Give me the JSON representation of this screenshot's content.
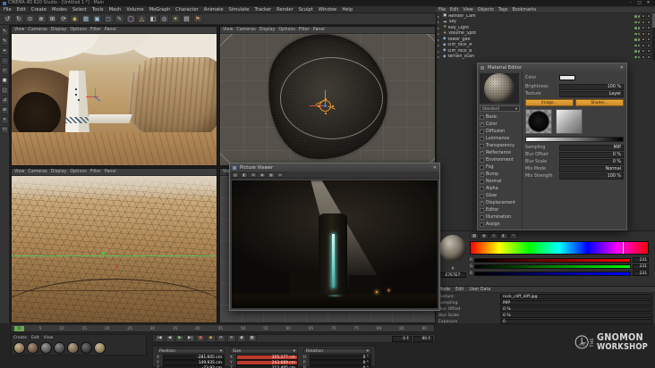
{
  "glyphs": {
    "caret": "▾",
    "close": "✕",
    "hash": "#"
  },
  "titlebar": {
    "title": "CINEMA 4D R20 Studio - [Untitled 1 *] - Main",
    "controls": [
      "–",
      "□",
      "✕"
    ]
  },
  "menubar": {
    "items": [
      "File",
      "Edit",
      "Create",
      "Modes",
      "Select",
      "Tools",
      "Mesh",
      "Volume",
      "MoGraph",
      "Character",
      "Animate",
      "Simulate",
      "Tracker",
      "Render",
      "Sculpt",
      "Window",
      "Help"
    ]
  },
  "toolbar": {
    "icons": [
      {
        "glyph": "↺",
        "color": "#cccccc"
      },
      {
        "glyph": "↻",
        "color": "#cccccc"
      },
      {
        "glyph": "⊙",
        "color": "#d8d8d8"
      },
      {
        "glyph": "⊕",
        "color": "#d8d8d8"
      },
      {
        "glyph": "⊞",
        "color": "#d8d8d8"
      },
      {
        "glyph": "⟳",
        "color": "#d8d8d8"
      },
      {
        "glyph": "◆",
        "color": "#c2a84e"
      },
      {
        "glyph": "▦",
        "color": "#9fc2dd"
      },
      {
        "glyph": "▣",
        "color": "#9fc2dd"
      },
      {
        "glyph": "◻",
        "color": "#8fb6d8"
      },
      {
        "glyph": "✎",
        "color": "#9ed09a"
      },
      {
        "glyph": "◯",
        "color": "#c9a2d8"
      },
      {
        "glyph": "△",
        "color": "#d8b98f"
      },
      {
        "glyph": "◧",
        "color": "#cccccc"
      },
      {
        "glyph": "◎",
        "color": "#cccccc"
      },
      {
        "glyph": "☀",
        "color": "#e2cf6f"
      },
      {
        "glyph": "▤",
        "color": "#cccccc"
      },
      {
        "glyph": "⚑",
        "color": "#cf8f5f"
      }
    ]
  },
  "left_toolbar": {
    "icons": [
      "↖",
      "✎",
      "⌖",
      "∴",
      "▱",
      "◼",
      "◻",
      "⊿",
      "≡",
      "⋄",
      "▭"
    ]
  },
  "viewports": {
    "menu": [
      "View",
      "Cameras",
      "Display",
      "Options",
      "Filter",
      "Panel"
    ]
  },
  "picture_viewer": {
    "title": "Picture Viewer",
    "toolbar_icons": [
      "▤",
      "◧",
      "⊞",
      "◉",
      "▦",
      "⇔"
    ]
  },
  "objects": {
    "menu": [
      "File",
      "Edit",
      "View",
      "Objects",
      "Tags",
      "Bookmarks"
    ],
    "rows": [
      {
        "icon": "▣",
        "c": "#cfd8de",
        "name": "Render_Cam"
      },
      {
        "icon": "☁",
        "c": "#9fc4e0",
        "name": "Sky"
      },
      {
        "icon": "☀",
        "c": "#e6cf6a",
        "name": "Key_Light"
      },
      {
        "icon": "☀",
        "c": "#e6cf6a",
        "name": "Volume_Spot"
      },
      {
        "icon": "◆",
        "c": "#8fb3d4",
        "name": "tower_geo"
      },
      {
        "icon": "◆",
        "c": "#8fb3d4",
        "name": "cliff_rock_A"
      },
      {
        "icon": "◆",
        "c": "#8fb3d4",
        "name": "cliff_rock_B"
      },
      {
        "icon": "◆",
        "c": "#8fb3d4",
        "name": "terrain_scan"
      }
    ]
  },
  "material_editor": {
    "title": "Material Editor",
    "shader_dropdown": "Standard",
    "channels": [
      {
        "label": "Basic",
        "check": ""
      },
      {
        "label": "Color",
        "check": "✓"
      },
      {
        "label": "Diffusion",
        "check": ""
      },
      {
        "label": "Luminance",
        "check": ""
      },
      {
        "label": "Transparency",
        "check": ""
      },
      {
        "label": "Reflectance",
        "check": "✓"
      },
      {
        "label": "Environment",
        "check": ""
      },
      {
        "label": "Fog",
        "check": ""
      },
      {
        "label": "Bump",
        "check": "✓"
      },
      {
        "label": "Normal",
        "check": ""
      },
      {
        "label": "Alpha",
        "check": ""
      },
      {
        "label": "Glow",
        "check": ""
      },
      {
        "label": "Displacement",
        "check": "✓"
      },
      {
        "label": "Editor",
        "check": ""
      },
      {
        "label": "Illumination",
        "check": ""
      },
      {
        "label": "Assign",
        "check": ""
      }
    ],
    "buttons": [
      {
        "label": "Image..."
      },
      {
        "label": "Shader..."
      }
    ],
    "rows": [
      {
        "label": "Brightness",
        "value": "100 %"
      },
      {
        "label": "Texture",
        "value": "Layer"
      }
    ],
    "color_label": "Color",
    "rows2": [
      {
        "label": "Sampling",
        "value": "MIP"
      },
      {
        "label": "Blur Offset",
        "value": "0 %"
      },
      {
        "label": "Blur Scale",
        "value": "0 %"
      },
      {
        "label": "Mix Mode",
        "value": "Normal"
      },
      {
        "label": "Mix Strength",
        "value": "100 %"
      }
    ]
  },
  "color_picker": {
    "modes": [
      "▦",
      "◉",
      "≡",
      "◧",
      "✎"
    ],
    "spectrum_css": "background:linear-gradient(90deg,#ff0000 0%,#ffff00 16%,#00ff00 33%,#00ffff 50%,#0000ff 66%,#ff00ff 83%,#ff0000 100%)",
    "sliders": [
      {
        "label": "R",
        "value": "231",
        "background": "linear-gradient(90deg,#000000,#ff0000)"
      },
      {
        "label": "G",
        "value": "231",
        "background": "linear-gradient(90deg,#000000,#00ff00)"
      },
      {
        "label": "B",
        "value": "231",
        "background": "linear-gradient(90deg,#000000,#0000ff)"
      }
    ],
    "hex": "E7E7E7"
  },
  "attributes": {
    "menu": [
      "Mode",
      "Edit",
      "User Data"
    ],
    "rows": [
      {
        "label": "Texture",
        "value": "rock_cliff_diff.jpg"
      },
      {
        "label": "Sampling",
        "value": "MIP"
      },
      {
        "label": "Blur Offset",
        "value": "0 %"
      },
      {
        "label": "Blur Scale",
        "value": "0 %"
      },
      {
        "label": "Exposure",
        "value": "0"
      }
    ]
  },
  "timeline": {
    "ticks": [
      "0",
      "5",
      "10",
      "15",
      "20",
      "25",
      "30",
      "35",
      "40",
      "45",
      "50",
      "55",
      "60",
      "65",
      "70",
      "75",
      "80",
      "85",
      "90"
    ],
    "playhead": "0",
    "frame_start": "0 F",
    "frame_end": "90 F"
  },
  "transport": {
    "icons": [
      {
        "glyph": "|◀",
        "color": "#c4c4c4"
      },
      {
        "glyph": "◀",
        "color": "#c4c4c4"
      },
      {
        "glyph": "▶",
        "color": "#9ccf7a"
      },
      {
        "glyph": "▶|",
        "color": "#c4c4c4"
      },
      {
        "glyph": "●",
        "color": "#d05848"
      },
      {
        "glyph": "◆",
        "color": "#d0a848"
      },
      {
        "glyph": "⟳",
        "color": "#c4c4c4"
      },
      {
        "glyph": "≡",
        "color": "#c4c4c4"
      },
      {
        "glyph": "◉",
        "color": "#c4c4c4"
      },
      {
        "glyph": "▦",
        "color": "#c4c4c4"
      }
    ]
  },
  "materials": {
    "menu": [
      "Create",
      "Edit",
      "View"
    ],
    "thumbs": [
      {
        "background": "radial-gradient(circle at 35% 30%, #cbb393, #7a6146 75%)"
      },
      {
        "background": "radial-gradient(circle at 35% 30%, #a8917a, #5c4a36 75%)"
      },
      {
        "background": "radial-gradient(circle at 35% 30%, #9a9a98, #4c4c4a 75%)"
      },
      {
        "background": "radial-gradient(circle at 35% 30%, #8a8a88, #3c3c3a 75%)"
      },
      {
        "background": "radial-gradient(circle at 35% 30%, #b5a58d, #6a5a42 75%)"
      },
      {
        "background": "radial-gradient(circle at 35% 30%, #6f6f6d, #30302e 75%)"
      },
      {
        "background": "radial-gradient(circle at 35% 30%, #c7b79b, #84704e 75%)"
      }
    ]
  },
  "coordinates": {
    "position_title": "Position",
    "size_title": "Size",
    "rotation_title": "Rotation",
    "position": [
      {
        "axis": "X",
        "value": "-281.605 cm",
        "bg": "#1e1e1e"
      },
      {
        "axis": "Y",
        "value": "149.935 cm",
        "bg": "#1e1e1e"
      },
      {
        "axis": "Z",
        "value": "-73.92 cm",
        "bg": "#1e1e1e"
      }
    ],
    "size": [
      {
        "axis": "X",
        "value": "355.277 cm",
        "bg": "#c0392b"
      },
      {
        "axis": "Y",
        "value": "243.689 cm",
        "bg": "#c0392b"
      },
      {
        "axis": "Z",
        "value": "212.405 cm",
        "bg": "#1e1e1e"
      }
    ],
    "rotation": [
      {
        "axis": "H",
        "value": "0 °",
        "bg": "#1e1e1e"
      },
      {
        "axis": "P",
        "value": "0 °",
        "bg": "#1e1e1e"
      },
      {
        "axis": "B",
        "value": "0 °",
        "bg": "#1e1e1e"
      }
    ]
  },
  "watermark": {
    "the": "THE",
    "line1": "GNOMON",
    "line2": "WORKSHOP"
  }
}
